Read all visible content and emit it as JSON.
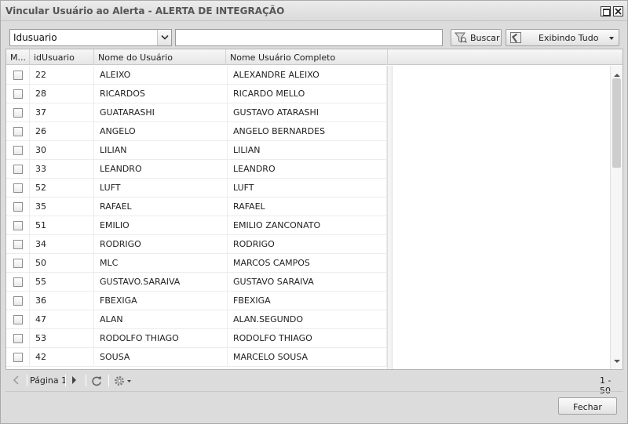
{
  "window": {
    "title": "Vincular Usuário ao Alerta - ALERTA DE INTEGRAÇÃO"
  },
  "toolbar": {
    "field_select_value": "Idusuario",
    "search_value": "",
    "search_button_label": "Buscar",
    "view_button_label": "Exibindo Tudo"
  },
  "grid": {
    "columns": [
      "M...",
      "idUsuario",
      "Nome do Usuário",
      "Nome Usuário Completo"
    ],
    "rows": [
      {
        "id": "22",
        "nome": "ALEIXO",
        "completo": "ALEXANDRE ALEIXO"
      },
      {
        "id": "28",
        "nome": "RICARDOS",
        "completo": "RICARDO MELLO"
      },
      {
        "id": "37",
        "nome": "GUATARASHI",
        "completo": "GUSTAVO ATARASHI"
      },
      {
        "id": "26",
        "nome": "ANGELO",
        "completo": "ANGELO BERNARDES"
      },
      {
        "id": "30",
        "nome": "LILIAN",
        "completo": "LILIAN"
      },
      {
        "id": "33",
        "nome": "LEANDRO",
        "completo": "LEANDRO"
      },
      {
        "id": "52",
        "nome": "LUFT",
        "completo": "LUFT"
      },
      {
        "id": "35",
        "nome": "RAFAEL",
        "completo": "RAFAEL"
      },
      {
        "id": "51",
        "nome": "EMILIO",
        "completo": "EMILIO ZANCONATO"
      },
      {
        "id": "34",
        "nome": "RODRIGO",
        "completo": "RODRIGO"
      },
      {
        "id": "50",
        "nome": "MLC",
        "completo": "MARCOS CAMPOS"
      },
      {
        "id": "55",
        "nome": "GUSTAVO.SARAIVA",
        "completo": "GUSTAVO SARAIVA"
      },
      {
        "id": "36",
        "nome": "FBEXIGA",
        "completo": "FBEXIGA"
      },
      {
        "id": "47",
        "nome": "ALAN",
        "completo": "ALAN.SEGUNDO"
      },
      {
        "id": "53",
        "nome": "RODOLFO THIAGO",
        "completo": "RODOLFO THIAGO"
      },
      {
        "id": "42",
        "nome": "SOUSA",
        "completo": "MARCELO SOUSA"
      }
    ]
  },
  "pager": {
    "page_label": "Página 1",
    "range": "1 - 50"
  },
  "footer": {
    "close_label": "Fechar"
  },
  "icons": {
    "maximize": "maximize-icon",
    "close": "close-icon",
    "dropdown": "chevron-down-icon",
    "search": "funnel-search-icon",
    "view": "cursor-select-icon",
    "first": "first-page-icon",
    "next": "next-page-icon",
    "refresh": "refresh-icon",
    "settings": "gear-icon"
  }
}
